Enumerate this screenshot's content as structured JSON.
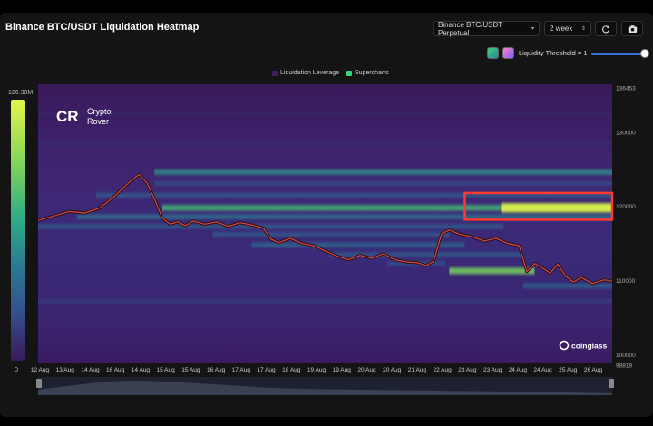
{
  "header": {
    "title": "Binance BTC/USDT Liquidation Heatmap",
    "pair_select": "Binance BTC/USDT Perpetual",
    "range_select": "2 week",
    "refresh_icon": "refresh-icon",
    "camera_icon": "camera-icon"
  },
  "controls": {
    "threshold_label": "Liquidity Threshold = 1",
    "threshold_value": 1,
    "swatch_colors": [
      "#3dd07a",
      "#ff7fc8"
    ]
  },
  "legend": {
    "items": [
      {
        "label": "Liquidation Leverage",
        "color": "#3b1f5e"
      },
      {
        "label": "Supercharts",
        "color": "#37d67a"
      }
    ]
  },
  "watermarks": {
    "logo_text": "CR",
    "brand_line1": "Crypto",
    "brand_line2": "Rover",
    "coinglass": "coinglass"
  },
  "colorbar": {
    "max_label": "126.30M",
    "min_label": "0",
    "colors": [
      "#e5f54a",
      "#7fd35a",
      "#2fae86",
      "#2a7f92",
      "#33548f",
      "#3d2f7c",
      "#3a1a5c"
    ]
  },
  "chart_data": {
    "type": "heatmap",
    "title": "Binance BTC/USDT Liquidation Heatmap",
    "x_tick_labels": [
      "12 Aug",
      "13 Aug",
      "14 Aug",
      "16 Aug",
      "14 Aug",
      "15 Aug",
      "15 Aug",
      "16 Aug",
      "17 Aug",
      "17 Aug",
      "18 Aug",
      "19 Aug",
      "19 Aug",
      "20 Aug",
      "20 Aug",
      "21 Aug",
      "22 Aug",
      "23 Aug",
      "23 Aug",
      "24 Aug",
      "24 Aug",
      "25 Aug",
      "26 Aug"
    ],
    "x_range_days": [
      12,
      26.8
    ],
    "y_tick_labels": [
      "136453",
      "130000",
      "120000",
      "110000",
      "100000",
      "98819"
    ],
    "y_range": [
      98819,
      136453
    ],
    "y_ticks": [
      136453,
      130000,
      120000,
      110000,
      100000,
      98819
    ],
    "colorbar_range": [
      0,
      126.3
    ],
    "liquidation_bands": [
      {
        "price": 124600,
        "start": 15.0,
        "end": 26.8,
        "intensity": 0.55
      },
      {
        "price": 123100,
        "start": 15.0,
        "end": 26.8,
        "intensity": 0.3
      },
      {
        "price": 121500,
        "start": 13.5,
        "end": 26.8,
        "intensity": 0.35
      },
      {
        "price": 119800,
        "start": 15.2,
        "end": 26.8,
        "intensity": 0.7
      },
      {
        "price": 118600,
        "start": 13.0,
        "end": 26.8,
        "intensity": 0.45
      },
      {
        "price": 117300,
        "start": 12.0,
        "end": 24.0,
        "intensity": 0.35
      },
      {
        "price": 116200,
        "start": 16.5,
        "end": 22.6,
        "intensity": 0.35
      },
      {
        "price": 114800,
        "start": 17.5,
        "end": 23.0,
        "intensity": 0.4
      },
      {
        "price": 113500,
        "start": 19.5,
        "end": 24.5,
        "intensity": 0.35
      },
      {
        "price": 112300,
        "start": 21.0,
        "end": 22.5,
        "intensity": 0.3
      },
      {
        "price": 111300,
        "start": 22.6,
        "end": 24.8,
        "intensity": 0.8
      },
      {
        "price": 109300,
        "start": 24.5,
        "end": 26.8,
        "intensity": 0.4
      },
      {
        "price": 107200,
        "start": 12.0,
        "end": 26.8,
        "intensity": 0.2
      },
      {
        "price": 128500,
        "start": 12.0,
        "end": 26.8,
        "intensity": 0.12
      },
      {
        "price": 132500,
        "start": 12.0,
        "end": 26.8,
        "intensity": 0.08
      }
    ],
    "price_series": [
      [
        12.0,
        118100
      ],
      [
        12.4,
        118700
      ],
      [
        12.8,
        119300
      ],
      [
        13.2,
        119100
      ],
      [
        13.6,
        119800
      ],
      [
        14.0,
        121500
      ],
      [
        14.4,
        123500
      ],
      [
        14.6,
        124300
      ],
      [
        14.8,
        123200
      ],
      [
        15.0,
        121000
      ],
      [
        15.2,
        118400
      ],
      [
        15.4,
        117600
      ],
      [
        15.6,
        117900
      ],
      [
        15.8,
        117400
      ],
      [
        16.0,
        118000
      ],
      [
        16.3,
        117600
      ],
      [
        16.6,
        117900
      ],
      [
        16.9,
        117300
      ],
      [
        17.2,
        117800
      ],
      [
        17.5,
        117500
      ],
      [
        17.8,
        117100
      ],
      [
        18.0,
        115600
      ],
      [
        18.2,
        115100
      ],
      [
        18.5,
        115700
      ],
      [
        18.8,
        115000
      ],
      [
        19.1,
        114700
      ],
      [
        19.4,
        114000
      ],
      [
        19.7,
        113300
      ],
      [
        20.0,
        112800
      ],
      [
        20.3,
        113400
      ],
      [
        20.6,
        113000
      ],
      [
        20.9,
        113600
      ],
      [
        21.2,
        112800
      ],
      [
        21.5,
        112500
      ],
      [
        21.8,
        112400
      ],
      [
        22.0,
        112000
      ],
      [
        22.2,
        112600
      ],
      [
        22.4,
        116300
      ],
      [
        22.6,
        116800
      ],
      [
        22.9,
        116200
      ],
      [
        23.2,
        115900
      ],
      [
        23.5,
        115300
      ],
      [
        23.8,
        115700
      ],
      [
        24.1,
        115000
      ],
      [
        24.4,
        114700
      ],
      [
        24.6,
        111200
      ],
      [
        24.8,
        112300
      ],
      [
        25.0,
        111700
      ],
      [
        25.2,
        111000
      ],
      [
        25.4,
        112200
      ],
      [
        25.6,
        110600
      ],
      [
        25.8,
        109800
      ],
      [
        26.0,
        110400
      ],
      [
        26.3,
        109600
      ],
      [
        26.6,
        110100
      ],
      [
        26.8,
        109900
      ]
    ],
    "highlight_box": {
      "x_start": 23.0,
      "x_end": 26.8,
      "y_low": 118200,
      "y_high": 121800,
      "color": "#ff3b2f"
    }
  }
}
